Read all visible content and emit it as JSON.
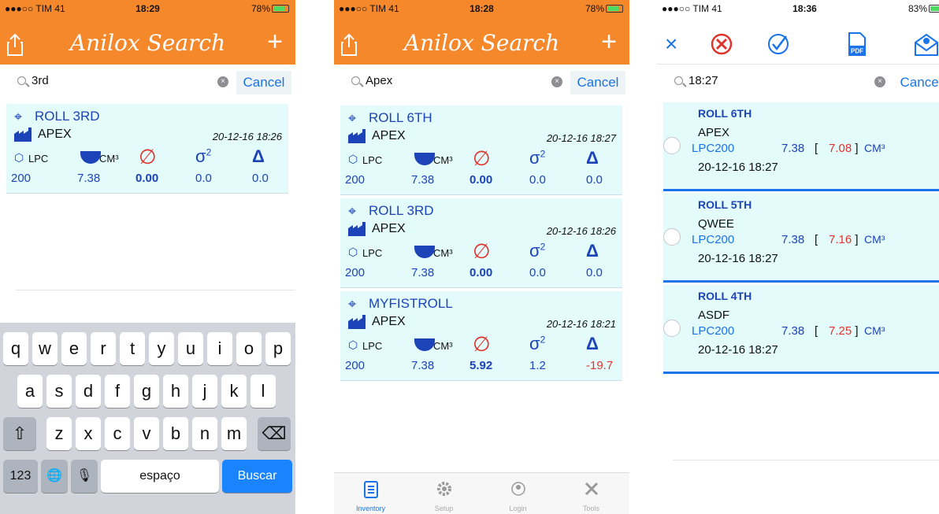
{
  "screens": [
    {
      "status": {
        "carrier": "●●●○○ TIM 41",
        "time": "18:29",
        "battery": "78%"
      },
      "title": "Anilox Search",
      "add_label": "+",
      "search": {
        "value": "3rd",
        "cancel": "Cancel"
      },
      "headers": {
        "lpc": "LPC",
        "cm": "CM³",
        "null": "∅",
        "sigma": "σ",
        "sq": "2",
        "delta": "Δ"
      },
      "cards": [
        {
          "roll": "ROLL 3RD",
          "maker": "APEX",
          "date": "20-12-16 18:26",
          "lpc": "200",
          "vol": "7.38",
          "dia": "0.00",
          "std": "0.0",
          "delta": "0.0"
        }
      ],
      "keyboard": {
        "row1": [
          "q",
          "w",
          "e",
          "r",
          "t",
          "y",
          "u",
          "i",
          "o",
          "p"
        ],
        "row2": [
          "a",
          "s",
          "d",
          "f",
          "g",
          "h",
          "j",
          "k",
          "l"
        ],
        "row3": [
          "z",
          "x",
          "c",
          "v",
          "b",
          "n",
          "m"
        ],
        "shift": "⇧",
        "backspace": "⌫",
        "num": "123",
        "globe": "🌐",
        "mic": "🎙",
        "space": "espaço",
        "search": "Buscar"
      }
    },
    {
      "status": {
        "carrier": "●●●○○ TIM 41",
        "time": "18:28",
        "battery": "78%"
      },
      "title": "Anilox Search",
      "add_label": "+",
      "search": {
        "value": "Apex",
        "cancel": "Cancel"
      },
      "headers": {
        "lpc": "LPC",
        "cm": "CM³",
        "null": "∅",
        "sigma": "σ",
        "sq": "2",
        "delta": "Δ"
      },
      "cards": [
        {
          "roll": "ROLL 6TH",
          "maker": "APEX",
          "date": "20-12-16 18:27",
          "lpc": "200",
          "vol": "7.38",
          "dia": "0.00",
          "std": "0.0",
          "delta": "0.0"
        },
        {
          "roll": "ROLL 3RD",
          "maker": "APEX",
          "date": "20-12-16 18:26",
          "lpc": "200",
          "vol": "7.38",
          "dia": "0.00",
          "std": "0.0",
          "delta": "0.0"
        },
        {
          "roll": "MYFISTROLL",
          "maker": "APEX",
          "date": "20-12-16 18:21",
          "lpc": "200",
          "vol": "7.38",
          "dia": "5.92",
          "std": "1.2",
          "delta": "-19.7"
        }
      ],
      "tabs": [
        "Inventory",
        "Setup",
        "Login",
        "Tools"
      ]
    },
    {
      "status": {
        "carrier": "●●●○○ TIM 41",
        "time": "18:36",
        "battery": "83%"
      },
      "toolbar": {
        "close": "×",
        "pdf": "PDF"
      },
      "search": {
        "value": "18:27",
        "cancel": "Cancel"
      },
      "rows": [
        {
          "roll": "ROLL 6TH",
          "maker": "APEX",
          "lpc_label": "LPC",
          "lpc": "200",
          "vol": "7.38",
          "lbr": "[",
          "meas": "7.08",
          "rbr": "]",
          "unit": "CM³",
          "ts": "20-12-16 18:27"
        },
        {
          "roll": "ROLL 5TH",
          "maker": "QWEE",
          "lpc_label": "LPC",
          "lpc": "200",
          "vol": "7.38",
          "lbr": "[",
          "meas": "7.16",
          "rbr": "]",
          "unit": "CM³",
          "ts": "20-12-16 18:27"
        },
        {
          "roll": "ROLL 4TH",
          "maker": "ASDF",
          "lpc_label": "LPC",
          "lpc": "200",
          "vol": "7.38",
          "lbr": "[",
          "meas": "7.25",
          "rbr": "]",
          "unit": "CM³",
          "ts": "20-12-16 18:27"
        }
      ]
    }
  ],
  "colors": {
    "orange": "#f6882c",
    "card_bg": "#e3fbfb",
    "navy": "#1c43b8",
    "blue": "#1a73e8",
    "red": "#e0332b"
  }
}
